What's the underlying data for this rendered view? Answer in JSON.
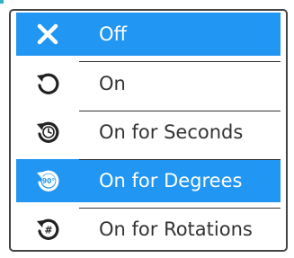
{
  "menu": {
    "items": [
      {
        "label": "Off",
        "icon": "close-icon",
        "selected": true
      },
      {
        "label": "On",
        "icon": "rotate-icon",
        "selected": false
      },
      {
        "label": "On for Seconds",
        "icon": "rotate-timer-icon",
        "selected": false
      },
      {
        "label": "On for Degrees",
        "icon": "rotate-degrees-icon",
        "icon_text": "90°",
        "selected": true
      },
      {
        "label": "On for Rotations",
        "icon": "rotate-count-icon",
        "icon_text": "#",
        "selected": false
      }
    ]
  },
  "colors": {
    "selected_background": "#2196f3",
    "text": "#333333",
    "selected_text": "#ffffff",
    "border": "#444444"
  }
}
